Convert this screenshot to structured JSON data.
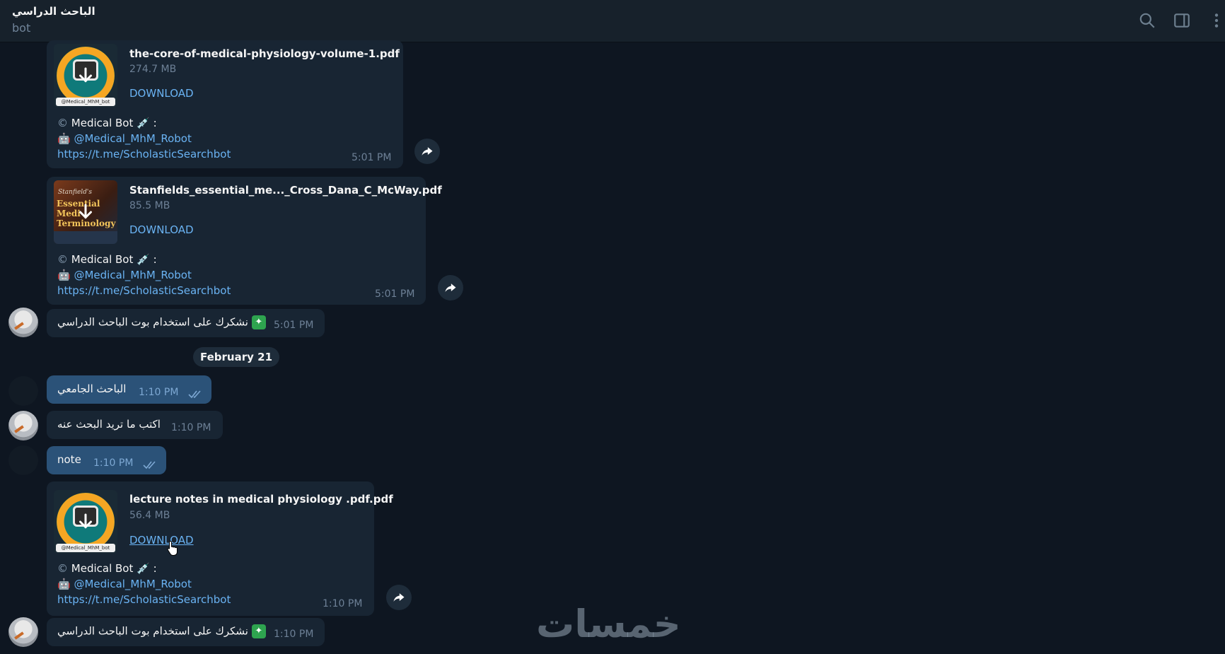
{
  "header": {
    "title": "الباحث الدراسي",
    "subtitle": "bot"
  },
  "messages": [
    {
      "file_name": "the-core-of-medical-physiology-volume-1.pdf",
      "file_size": "274.7 MB",
      "download": "DOWNLOAD",
      "caption_1_prefix": "©",
      "caption_1": "Medical Bot 💉 :",
      "caption_2_prefix": "🤖",
      "caption_2": "@Medical_MhM_Robot",
      "caption_3": "https://t.me/ScholasticSearchbot",
      "time": "5:01 PM",
      "thumb_tag": "@Medical_MhM_bot"
    },
    {
      "file_name": "Stanfields_essential_me..._Cross_Dana_C_McWay.pdf",
      "file_size": "85.5 MB",
      "download": "DOWNLOAD",
      "caption_1_prefix": "©",
      "caption_1": "Medical Bot 💉 :",
      "caption_2_prefix": "🤖",
      "caption_2": "@Medical_MhM_Robot",
      "caption_3": "https://t.me/ScholasticSearchbot",
      "time": "5:01 PM",
      "thumb_sub": "Stanfield's",
      "thumb_title": "Essential Medi Terminology"
    },
    {
      "text": "نشكرك على استخدام بوت الباحث الدراسي",
      "icon": "✦",
      "time": "5:01 PM"
    },
    {
      "date": "February 21"
    },
    {
      "text": "الباحث الجامعي",
      "time": "1:10 PM"
    },
    {
      "text": "اكتب ما تريد البحث عنه",
      "time": "1:10 PM"
    },
    {
      "text": "note",
      "time": "1:10 PM"
    },
    {
      "file_name": "lecture notes in medical physiology .pdf.pdf",
      "file_size": "56.4 MB",
      "download": "DOWNLOAD",
      "caption_1_prefix": "©",
      "caption_1": "Medical Bot 💉 :",
      "caption_2_prefix": "🤖",
      "caption_2": "@Medical_MhM_Robot",
      "caption_3": "https://t.me/ScholasticSearchbot",
      "time": "1:10 PM",
      "thumb_tag": "@Medical_MhM_bot"
    },
    {
      "text": "نشكرك على استخدام بوت الباحث الدراسي",
      "icon": "✦",
      "time": "1:10 PM"
    }
  ],
  "watermark": "خمسات",
  "icons": [
    "search-icon",
    "sidebar-toggle-icon",
    "more-vertical-icon",
    "download-arrow-icon",
    "share-icon",
    "double-check-icon",
    "cursor-hand-icon"
  ],
  "colors": {
    "background": "#0e1621",
    "header": "#17212b",
    "incoming_bubble": "#182533",
    "outgoing_bubble": "#2b5278",
    "link": "#6ab3f3"
  }
}
